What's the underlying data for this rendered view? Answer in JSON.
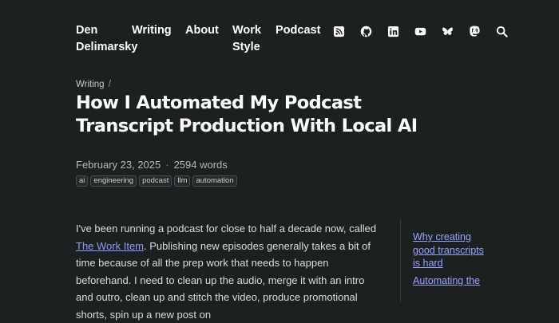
{
  "nav": {
    "brand": "Den Delimarsky",
    "links": [
      "Writing",
      "About",
      "Work Style",
      "Podcast"
    ],
    "icons": [
      "rss-icon",
      "github-icon",
      "linkedin-icon",
      "youtube-icon",
      "bluesky-icon",
      "mastodon-icon",
      "search-icon"
    ]
  },
  "breadcrumb": {
    "section": "Writing",
    "separator": "/"
  },
  "post": {
    "title": "How I Automated My Podcast Transcript Production With Local AI",
    "date": "February 23, 2025",
    "separator": "·",
    "word_count": "2594 words",
    "tags": [
      "ai",
      "engineering",
      "podcast",
      "llm",
      "automation"
    ],
    "body": {
      "before_link": "I've been running a podcast for close to half a decade now, called ",
      "link_text": "The Work Item",
      "after_link": ". Publishing new episodes generally takes a bit of time because of all the prep work that needs to happen beforehand. I need to clean up the audio, merge it with an intro and outro, clean up and stitch the video, produce promotional shorts, spin up a new post on"
    }
  },
  "toc": {
    "items": [
      "Why creating good transcripts is hard",
      "Automating the"
    ]
  },
  "colors": {
    "background": "#1d2021",
    "link": "#8f9bff",
    "text": "#dcdcdc"
  }
}
